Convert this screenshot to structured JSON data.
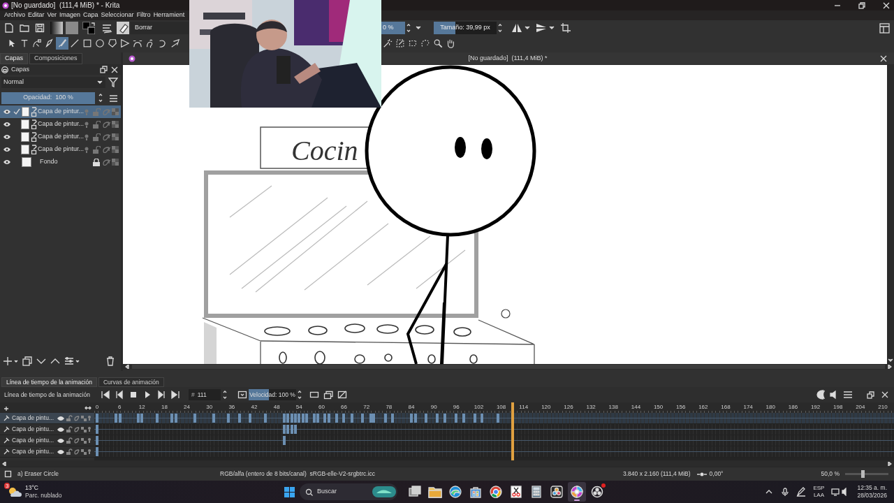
{
  "title_bar": {
    "title": "[No guardado]  (111,4 MiB) * - Krita"
  },
  "menu": [
    "Archivo",
    "Editar",
    "Ver",
    "Imagen",
    "Capa",
    "Seleccionar",
    "Filtro",
    "Herramient"
  ],
  "toolbar": {
    "preset": "Borrar",
    "opacity": {
      "value": "0 %",
      "level": 1
    },
    "size": {
      "value": "Tamaño: 39,99 px",
      "level": 0.34
    }
  },
  "tools": [
    {
      "kind": "pointer",
      "selected": false
    },
    {
      "kind": "text",
      "selected": false
    },
    {
      "kind": "shape-edit",
      "selected": false
    },
    {
      "kind": "pen",
      "selected": false
    },
    {
      "kind": "brush",
      "selected": true
    },
    {
      "kind": "line",
      "selected": false
    },
    {
      "kind": "rectangle",
      "selected": false
    },
    {
      "kind": "ellipse",
      "selected": false
    },
    {
      "kind": "polygon",
      "selected": false
    },
    {
      "kind": "polyline",
      "selected": false
    },
    {
      "kind": "bezier",
      "selected": false
    },
    {
      "kind": "freehand",
      "selected": false
    },
    {
      "kind": "curve",
      "selected": false
    },
    {
      "kind": "dynamic",
      "selected": false
    },
    {
      "kind": "wand",
      "selected": false
    },
    {
      "kind": "similar",
      "selected": false
    },
    {
      "kind": "bezier-select",
      "selected": false
    },
    {
      "kind": "lasso",
      "selected": false
    },
    {
      "kind": "zoom",
      "selected": false
    },
    {
      "kind": "pan",
      "selected": false
    }
  ],
  "docker": {
    "tabs": [
      {
        "label": "Capas",
        "selected": true
      },
      {
        "label": "Composiciones",
        "selected": false
      }
    ],
    "title": "Capas",
    "blend_mode": "Normal",
    "opacity": {
      "label": "Opacidad:  100 %",
      "level": 1
    },
    "layers": [
      {
        "name": "Capa de pintur...",
        "kind": "paint",
        "selected": true,
        "locked": false
      },
      {
        "name": "Capa de pintur...",
        "kind": "paint",
        "selected": false,
        "locked": false
      },
      {
        "name": "Capa de pintur...",
        "kind": "paint",
        "selected": false,
        "locked": false
      },
      {
        "name": "Capa de pintur...",
        "kind": "paint",
        "selected": false,
        "locked": false
      },
      {
        "name": "Fondo",
        "kind": "background",
        "selected": false,
        "locked": true
      }
    ]
  },
  "canvas": {
    "tab_title": "[No guardado]  (111,4 MiB) *",
    "sign_text": "Cocin"
  },
  "timeline": {
    "tabs": [
      {
        "label": "Línea de tiempo de la animación",
        "selected": true
      },
      {
        "label": "Curvas de animación",
        "selected": false
      }
    ],
    "title": "Línea de tiempo de la animación",
    "frame_label": "#",
    "frame": "111",
    "speed": {
      "label": "Velocidad: 100 %",
      "level": 0.42
    },
    "ruler": [
      "0",
      "6",
      "12",
      "18",
      "24",
      "30",
      "36",
      "42",
      "48",
      "54",
      "60",
      "66",
      "72",
      "78",
      "84",
      "90",
      "96",
      "102",
      "108",
      "114",
      "120",
      "126",
      "132",
      "138",
      "144",
      "150",
      "156",
      "162",
      "168",
      "174",
      "180",
      "186",
      "192",
      "198",
      "204",
      "210"
    ],
    "playhead": {
      "level": 0.529
    },
    "layers": [
      {
        "name": "Capa de pintu...",
        "selected": true,
        "keyframes": [
          {
            "level": 0
          },
          {
            "level": 0.024
          },
          {
            "level": 0.029
          },
          {
            "level": 0.052
          },
          {
            "level": 0.057
          },
          {
            "level": 0.076
          },
          {
            "level": 0.095
          },
          {
            "level": 0.1
          },
          {
            "level": 0.124
          },
          {
            "level": 0.148
          },
          {
            "level": 0.167
          },
          {
            "level": 0.181
          },
          {
            "level": 0.195
          },
          {
            "level": 0.214
          },
          {
            "level": 0.238
          },
          {
            "level": 0.243
          },
          {
            "level": 0.248
          },
          {
            "level": 0.252
          },
          {
            "level": 0.257
          },
          {
            "level": 0.262
          },
          {
            "level": 0.267
          },
          {
            "level": 0.276
          },
          {
            "level": 0.281
          },
          {
            "level": 0.29
          },
          {
            "level": 0.295
          },
          {
            "level": 0.305
          },
          {
            "level": 0.314
          },
          {
            "level": 0.324
          },
          {
            "level": 0.338
          },
          {
            "level": 0.348
          },
          {
            "level": 0.352
          },
          {
            "level": 0.367
          },
          {
            "level": 0.376
          },
          {
            "level": 0.4
          },
          {
            "level": 0.405
          },
          {
            "level": 0.419
          },
          {
            "level": 0.433
          },
          {
            "level": 0.443
          },
          {
            "level": 0.457
          },
          {
            "level": 0.467
          },
          {
            "level": 0.481
          },
          {
            "level": 0.49
          },
          {
            "level": 0.51
          }
        ]
      },
      {
        "name": "Capa de pintu...",
        "selected": false,
        "keyframes": [
          {
            "level": 0
          },
          {
            "level": 0.238
          },
          {
            "level": 0.243
          },
          {
            "level": 0.248
          },
          {
            "level": 0.252
          }
        ]
      },
      {
        "name": "Capa de pintu...",
        "selected": false,
        "keyframes": [
          {
            "level": 0
          },
          {
            "level": 0.238
          }
        ]
      },
      {
        "name": "Capa de pintu...",
        "selected": false,
        "keyframes": [
          {
            "level": 0
          }
        ]
      }
    ]
  },
  "status_bar": {
    "tool": "a) Eraser Circle",
    "color_space": "RGB/alfa (entero de 8 bits/canal)  sRGB-elle-V2-srgbtrc.icc",
    "size": "3.840 x 2.160 (111,4 MiB)",
    "rotation": "0,00°",
    "zoom": "50,0 %",
    "zoom_slider": {
      "level": 0.4
    }
  },
  "taskbar": {
    "weather": {
      "temperature": "13°C",
      "condition": "Parc. nublado",
      "badge": "3"
    },
    "search": {
      "placeholder": "Buscar"
    },
    "apps": [
      {
        "kind": "task-view",
        "active": false,
        "notification": false
      },
      {
        "kind": "folder",
        "active": false,
        "notification": false
      },
      {
        "kind": "edge",
        "active": false,
        "notification": false
      },
      {
        "kind": "store",
        "active": false,
        "notification": false
      },
      {
        "kind": "chrome",
        "active": false,
        "notification": false
      },
      {
        "kind": "snip",
        "active": false,
        "notification": false
      },
      {
        "kind": "calculator",
        "active": false,
        "notification": false
      },
      {
        "kind": "resolve",
        "active": false,
        "notification": false
      },
      {
        "kind": "krita",
        "active": true,
        "notification": false
      },
      {
        "kind": "recorder",
        "active": false,
        "notification": true
      }
    ],
    "language": "ESP",
    "layout": "LAA",
    "time": "12:35 a. m.",
    "date": "28/03/2026"
  }
}
